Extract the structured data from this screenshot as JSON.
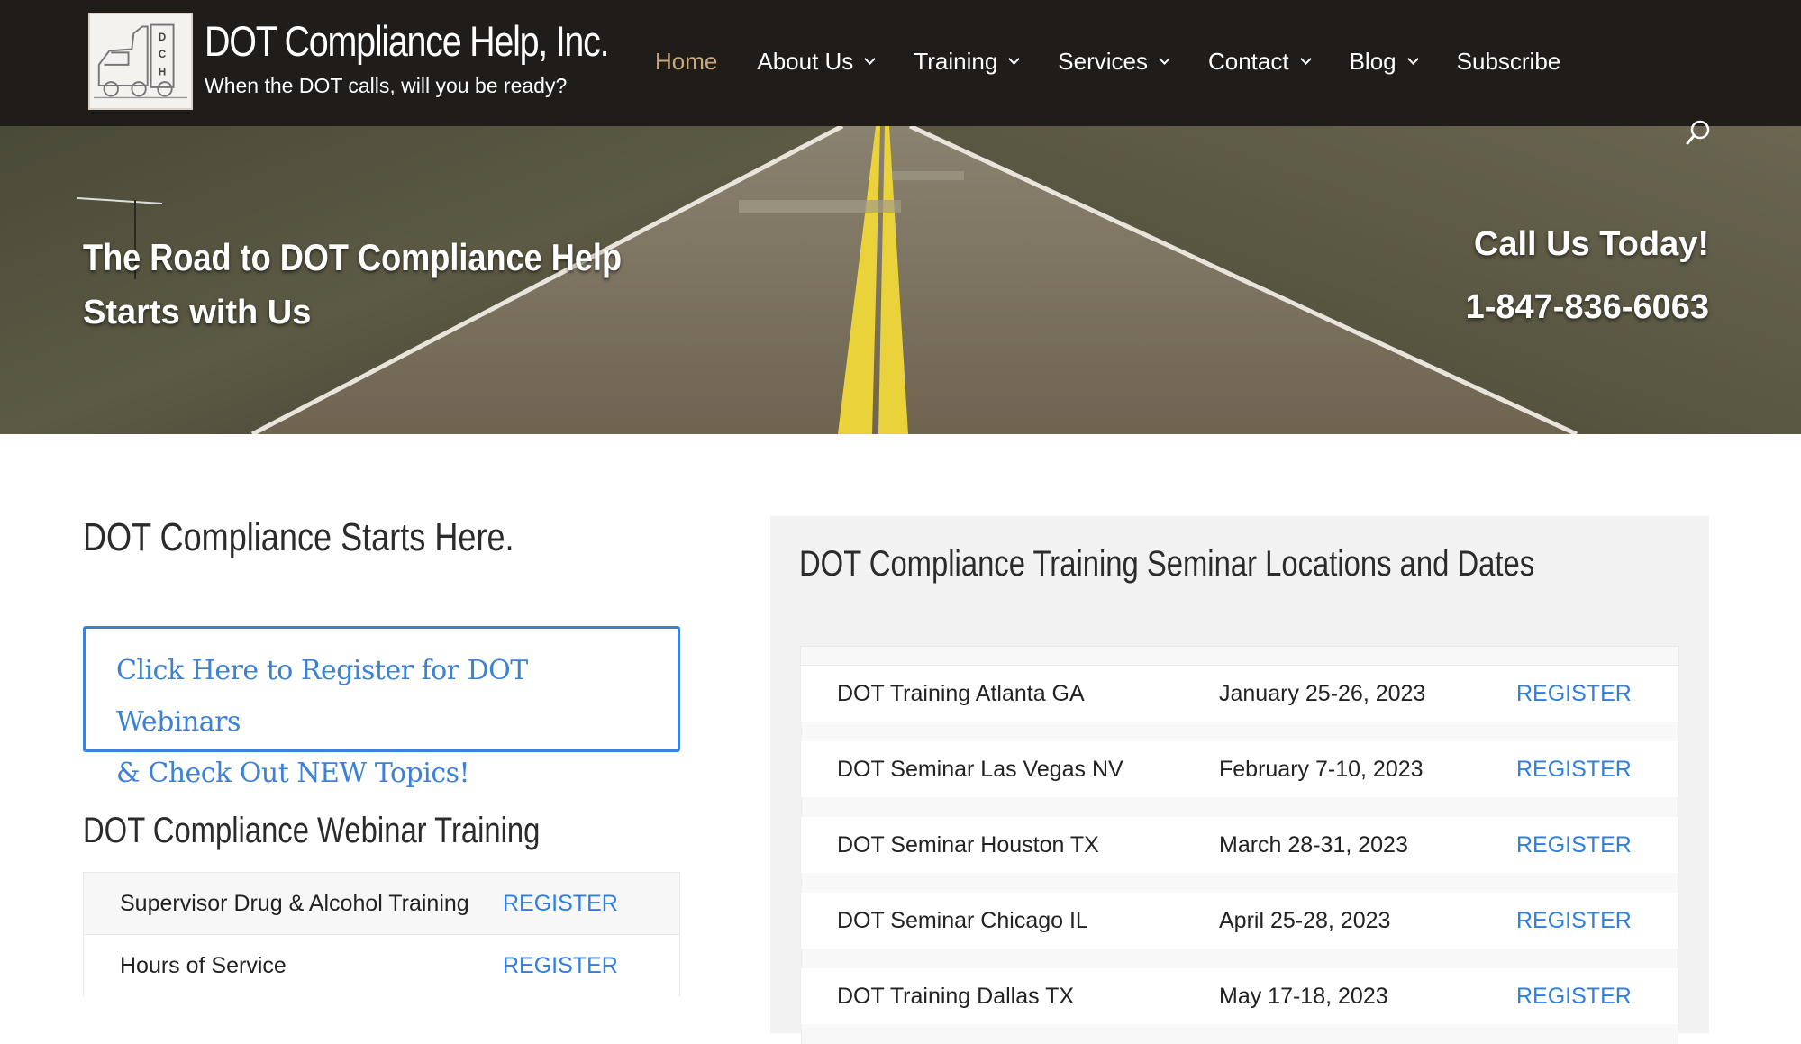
{
  "header": {
    "brand_name": "DOT Compliance Help, Inc.",
    "brand_tagline": "When the DOT calls, will you be ready?",
    "logo_letters": "DCH",
    "nav": [
      {
        "label": "Home",
        "active": true,
        "has_dropdown": false
      },
      {
        "label": "About Us",
        "active": false,
        "has_dropdown": true
      },
      {
        "label": "Training",
        "active": false,
        "has_dropdown": true
      },
      {
        "label": "Services",
        "active": false,
        "has_dropdown": true
      },
      {
        "label": "Contact",
        "active": false,
        "has_dropdown": true
      },
      {
        "label": "Blog",
        "active": false,
        "has_dropdown": true
      },
      {
        "label": "Subscribe",
        "active": false,
        "has_dropdown": false
      }
    ],
    "active_color": "#c8a97a"
  },
  "hero": {
    "title": "The Road to DOT Compliance Help",
    "subtitle": "Starts with Us",
    "call_title": "Call Us Today!",
    "phone": "1-847-836-6063",
    "search_icon": "search-icon"
  },
  "left": {
    "heading": "DOT Compliance Starts Here.",
    "promo_line1": "Click Here to Register for DOT Webinars",
    "promo_line2": "& Check Out NEW Topics!",
    "webinar_heading": "DOT Compliance Webinar Training",
    "webinars": [
      {
        "name": "Supervisor Drug & Alcohol Training",
        "action": "REGISTER"
      },
      {
        "name": "Hours of Service",
        "action": "REGISTER"
      }
    ]
  },
  "right": {
    "heading": "DOT Compliance Training Seminar Locations and Dates",
    "seminars": [
      {
        "city": "DOT Training Atlanta GA",
        "dates": "January 25-26, 2023",
        "action": "REGISTER"
      },
      {
        "city": "DOT Seminar Las Vegas NV",
        "dates": "February 7-10, 2023",
        "action": "REGISTER"
      },
      {
        "city": "DOT Seminar Houston TX",
        "dates": "March 28-31, 2023",
        "action": "REGISTER"
      },
      {
        "city": "DOT Seminar Chicago IL",
        "dates": "April 25-28, 2023",
        "action": "REGISTER"
      },
      {
        "city": "DOT Training Dallas TX",
        "dates": "May 17-18, 2023",
        "action": "REGISTER"
      }
    ]
  },
  "colors": {
    "header_bg": "#1f1c19",
    "link_blue": "#2f7ee0",
    "promo_blue": "#3b82d6",
    "panel_bg": "#f2f2f2"
  }
}
